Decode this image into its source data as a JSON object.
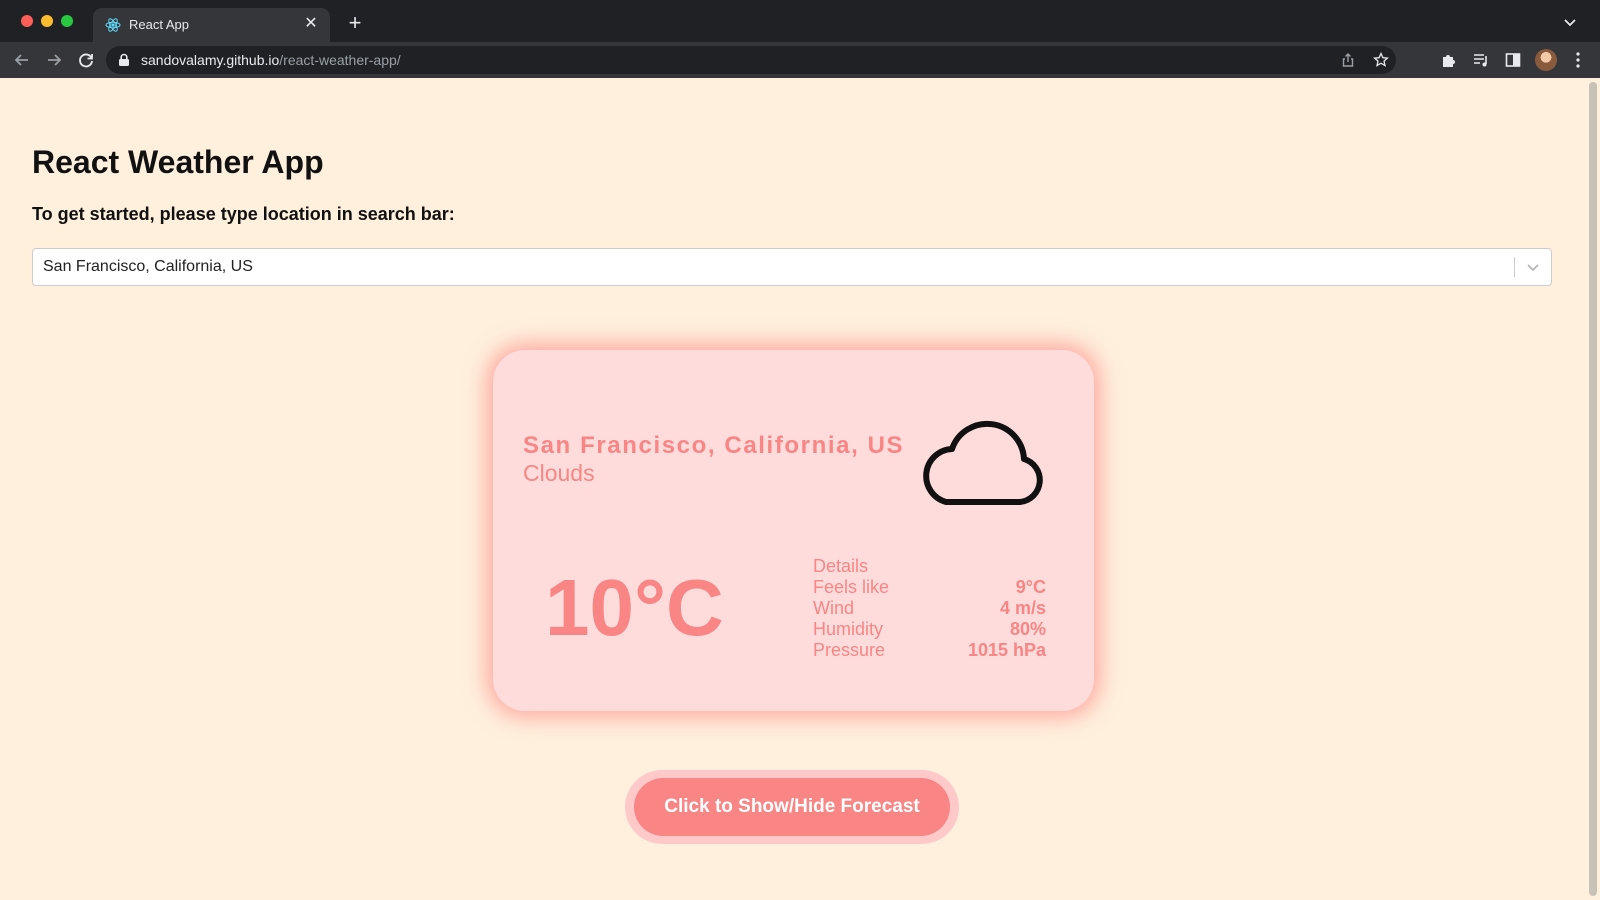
{
  "browser": {
    "tab_title": "React App",
    "url_host": "sandovalamy.github.io",
    "url_path": "/react-weather-app/"
  },
  "page": {
    "title": "React Weather App",
    "instruction": "To get started, please type location in search bar:",
    "search": {
      "value": "San Francisco, California, US"
    }
  },
  "weather": {
    "city": "San Francisco, California, US",
    "description": "Clouds",
    "icon": "cloud-icon",
    "temperature": "10°C",
    "details_title": "Details",
    "details": [
      {
        "label": "Feels like",
        "value": "9°C"
      },
      {
        "label": "Wind",
        "value": "4 m/s"
      },
      {
        "label": "Humidity",
        "value": "80%"
      },
      {
        "label": "Pressure",
        "value": "1015 hPa"
      }
    ]
  },
  "forecast_button_label": "Click to Show/Hide Forecast",
  "colors": {
    "page_background": "#fef0dd",
    "card_background": "#ffdcdc",
    "accent": "#f98585"
  }
}
